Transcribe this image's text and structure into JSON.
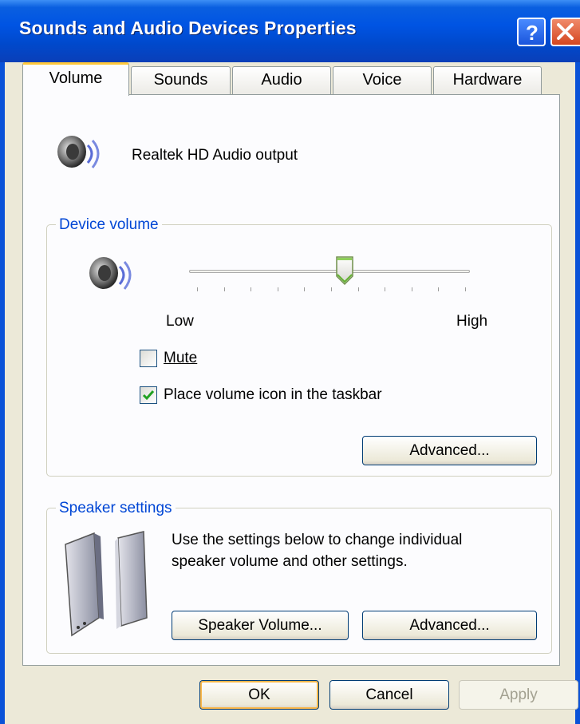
{
  "window": {
    "title": "Sounds and Audio Devices Properties",
    "help_icon": "question-icon",
    "close_icon": "close-icon"
  },
  "tabs": [
    {
      "label": "Volume",
      "active": true
    },
    {
      "label": "Sounds",
      "active": false
    },
    {
      "label": "Audio",
      "active": false
    },
    {
      "label": "Voice",
      "active": false
    },
    {
      "label": "Hardware",
      "active": false
    }
  ],
  "device": {
    "name": "Realtek HD Audio output",
    "icon": "speaker-icon"
  },
  "device_volume": {
    "group_label": "Device volume",
    "low_label": "Low",
    "high_label": "High",
    "volume_level": 0.55,
    "mute_label": "Mute",
    "mute_checked": false,
    "taskbar_label": "Place volume icon in the taskbar",
    "taskbar_checked": true,
    "advanced_label": "Advanced..."
  },
  "speaker_settings": {
    "group_label": "Speaker settings",
    "description_line1": "Use the settings below to change individual",
    "description_line2": "speaker volume and other settings.",
    "speaker_volume_label": "Speaker Volume...",
    "advanced_label": "Advanced..."
  },
  "footer": {
    "ok_label": "OK",
    "cancel_label": "Cancel",
    "apply_label": "Apply"
  }
}
